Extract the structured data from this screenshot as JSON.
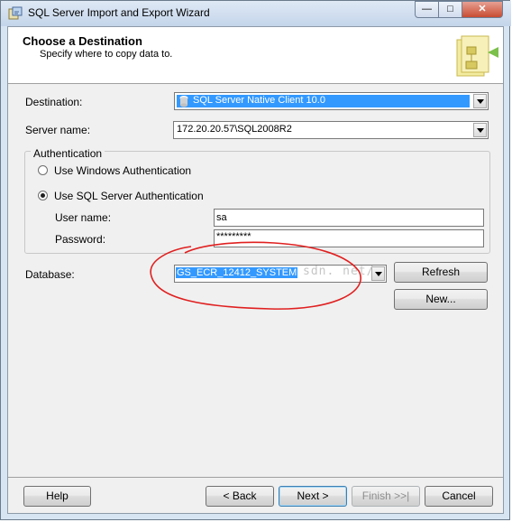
{
  "window": {
    "title": "SQL Server Import and Export Wizard"
  },
  "header": {
    "title": "Choose a Destination",
    "subtitle": "Specify where to copy data to."
  },
  "form": {
    "destination_label": "Destination:",
    "destination_value": "SQL Server Native Client 10.0",
    "server_label": "Server name:",
    "server_value": "172.20.20.57\\SQL2008R2",
    "auth_caption": "Authentication",
    "auth_windows": "Use Windows Authentication",
    "auth_sql": "Use SQL Server Authentication",
    "username_label": "User name:",
    "username_value": "sa",
    "password_label": "Password:",
    "password_value": "*********",
    "database_label": "Database:",
    "database_value": "GS_ECR_12412_SYSTEM",
    "refresh_label": "Refresh",
    "new_label": "New..."
  },
  "watermark": "sdn. net/",
  "footer": {
    "help": "Help",
    "back": "< Back",
    "next": "Next >",
    "finish": "Finish >>|",
    "cancel": "Cancel"
  },
  "colors": {
    "selection": "#3399ff",
    "annotation": "#e02020",
    "titlebar": "#c4d5ea"
  }
}
